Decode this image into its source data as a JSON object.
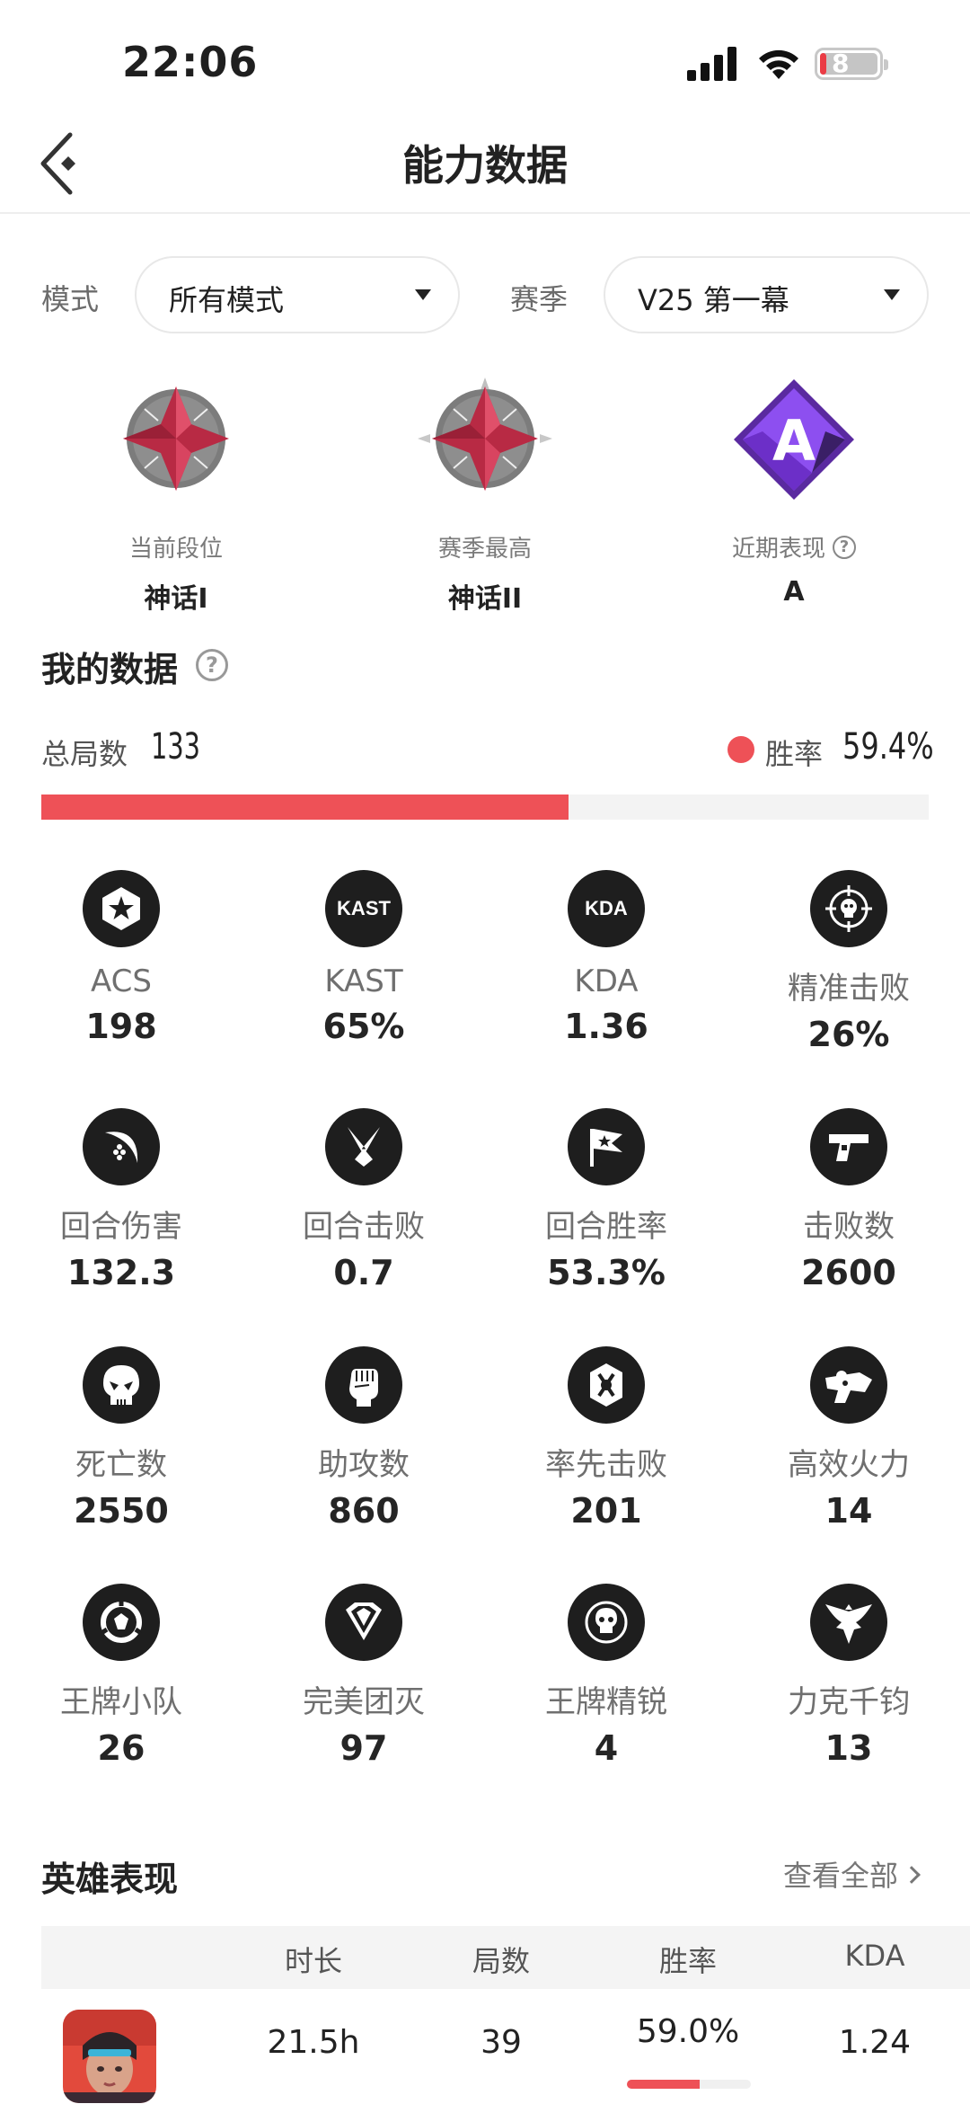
{
  "status_bar": {
    "time": "22:06",
    "battery": "8"
  },
  "nav": {
    "title": "能力数据"
  },
  "filters": {
    "mode_label": "模式",
    "mode_value": "所有模式",
    "season_label": "赛季",
    "season_value": "V25 第一幕"
  },
  "ranks": [
    {
      "label": "当前段位",
      "value": "神话I"
    },
    {
      "label": "赛季最高",
      "value": "神话II"
    },
    {
      "label": "近期表现",
      "value": "A",
      "badge_letter": "A"
    }
  ],
  "my_data": {
    "title": "我的数据",
    "total_label": "总局数",
    "total_value": "133",
    "win_label": "胜率",
    "win_value": "59.4%",
    "win_fraction": 0.594
  },
  "stats": [
    {
      "name": "ACS",
      "value": "198",
      "icon": "star-hexagon-icon",
      "icon_text": ""
    },
    {
      "name": "KAST",
      "value": "65%",
      "icon": "kast-icon",
      "icon_text": "KAST"
    },
    {
      "name": "KDA",
      "value": "1.36",
      "icon": "kda-icon",
      "icon_text": "KDA"
    },
    {
      "name": "精准击败",
      "value": "26%",
      "icon": "crosshair-skull-icon",
      "icon_text": ""
    },
    {
      "name": "回合伤害",
      "value": "132.3",
      "icon": "slash-burst-icon",
      "icon_text": ""
    },
    {
      "name": "回合击败",
      "value": "0.7",
      "icon": "crossed-blades-icon",
      "icon_text": ""
    },
    {
      "name": "回合胜率",
      "value": "53.3%",
      "icon": "flag-icon",
      "icon_text": ""
    },
    {
      "name": "击败数",
      "value": "2600",
      "icon": "pistol-icon",
      "icon_text": ""
    },
    {
      "name": "死亡数",
      "value": "2550",
      "icon": "skull-icon",
      "icon_text": ""
    },
    {
      "name": "助攻数",
      "value": "860",
      "icon": "fist-icon",
      "icon_text": ""
    },
    {
      "name": "率先击败",
      "value": "201",
      "icon": "first-blood-icon",
      "icon_text": ""
    },
    {
      "name": "高效火力",
      "value": "14",
      "icon": "gun-burst-icon",
      "icon_text": ""
    },
    {
      "name": "王牌小队",
      "value": "26",
      "icon": "ace-squad-icon",
      "icon_text": ""
    },
    {
      "name": "完美团灭",
      "value": "97",
      "icon": "diamond-icon",
      "icon_text": ""
    },
    {
      "name": "王牌精锐",
      "value": "4",
      "icon": "elite-skull-icon",
      "icon_text": ""
    },
    {
      "name": "力克千钧",
      "value": "13",
      "icon": "eagle-icon",
      "icon_text": ""
    }
  ],
  "heroes": {
    "title": "英雄表现",
    "view_all": "查看全部",
    "columns": [
      "时长",
      "局数",
      "胜率",
      "KDA"
    ],
    "rows": [
      {
        "duration": "21.5h",
        "games": "39",
        "win_rate": "59.0%",
        "win_fraction": 0.59,
        "kda": "1.24"
      }
    ]
  },
  "colors": {
    "accent": "#ee5157",
    "icon_bg": "#1e1e1e",
    "rank_red": "#c8364a",
    "rank_purple": "#7e3fd6"
  }
}
